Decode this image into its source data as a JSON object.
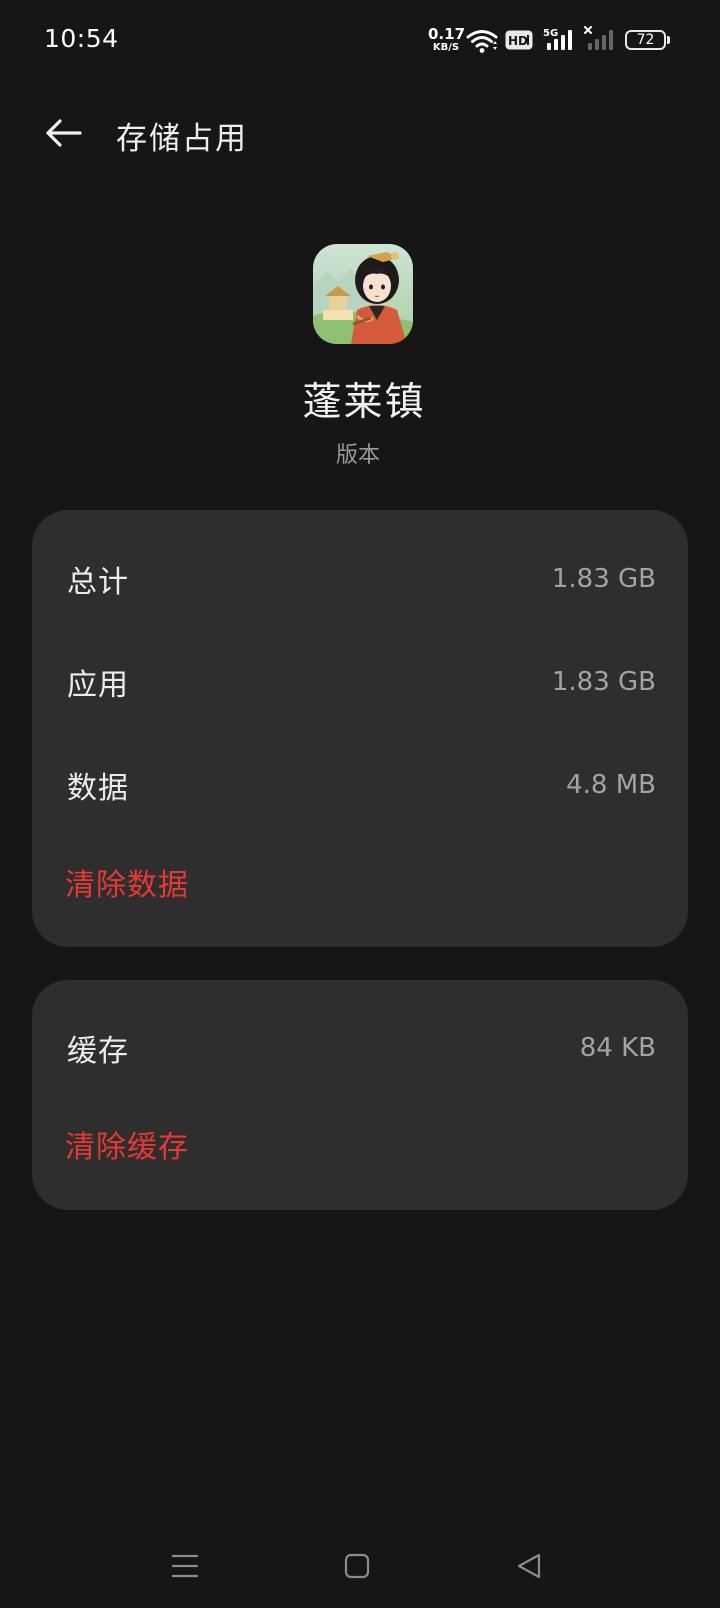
{
  "status_bar": {
    "time": "10:54",
    "net_speed_value": "0.17",
    "net_speed_unit": "KB/S",
    "hd_label": "HD",
    "network_label": "5G",
    "battery_level": "72",
    "icons": [
      "wifi-icon",
      "hd-icon",
      "signal-5g-icon",
      "signal-2-icon",
      "battery-icon"
    ]
  },
  "header": {
    "title": "存储占用",
    "back_icon": "arrow-left-icon"
  },
  "app": {
    "name": "蓬莱镇",
    "version_label": "版本"
  },
  "storage_card": {
    "rows": [
      {
        "label": "总计",
        "value": "1.83 GB"
      },
      {
        "label": "应用",
        "value": "1.83 GB"
      },
      {
        "label": "数据",
        "value": "4.8 MB"
      }
    ],
    "action_label": "清除数据"
  },
  "cache_card": {
    "rows": [
      {
        "label": "缓存",
        "value": "84 KB"
      }
    ],
    "action_label": "清除缓存"
  },
  "nav_bar": {
    "icons": [
      "menu-icon",
      "home-icon",
      "back-triangle-icon"
    ]
  },
  "colors": {
    "background": "#161616",
    "card": "#2e2e2e",
    "danger": "#e53935",
    "secondary_text": "#a3a3a3"
  }
}
